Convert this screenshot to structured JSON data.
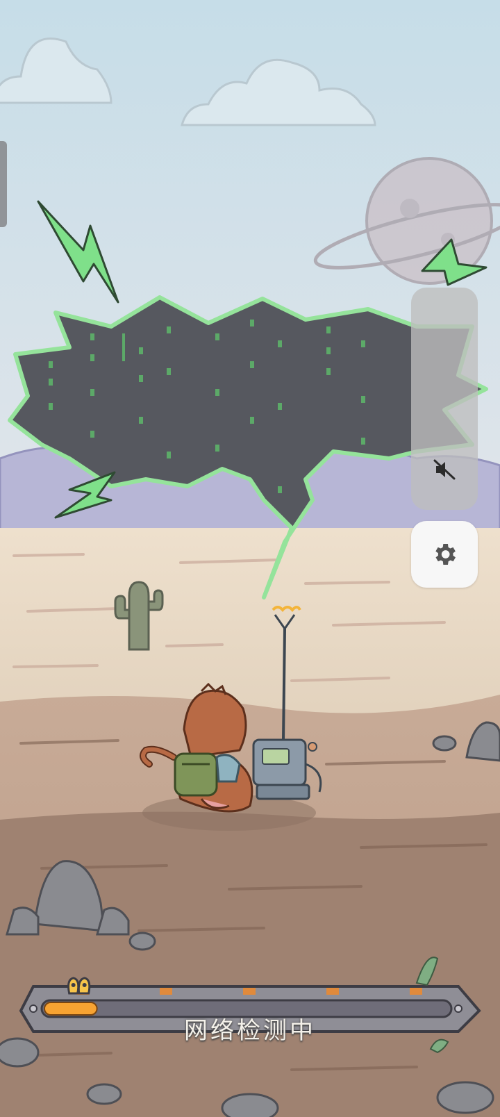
{
  "loading": {
    "status_text": "网络检测中",
    "progress_fraction": 0.13
  },
  "controls": {
    "volume_icon": "speaker-muted-icon",
    "settings_icon": "gear-icon"
  },
  "colors": {
    "sky": "#cfe2ea",
    "ground": "#e9dcc8",
    "bolt_green": "#7fe08a",
    "cloud_bubble": "#56585f",
    "progress_fill": "#f7a332"
  }
}
